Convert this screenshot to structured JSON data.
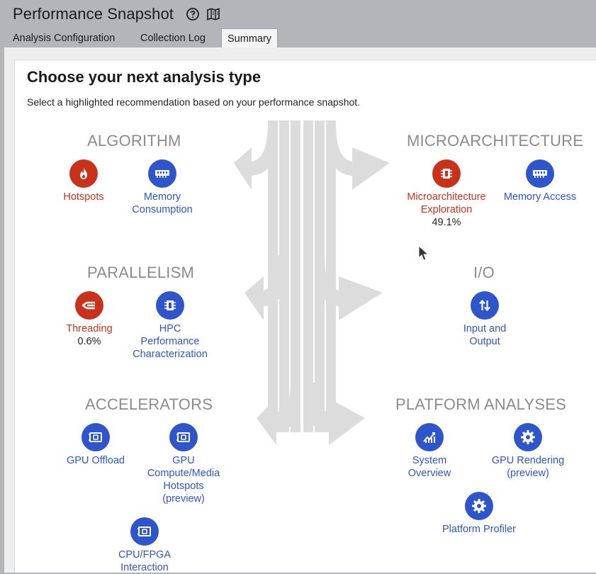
{
  "app": {
    "title": "Performance Snapshot",
    "help_icon": "question-circle-icon",
    "docs_icon": "book-map-icon"
  },
  "tabs": [
    {
      "label": "Analysis Configuration",
      "active": false
    },
    {
      "label": "Collection Log",
      "active": false
    },
    {
      "label": "Summary",
      "active": true
    }
  ],
  "summary": {
    "heading": "Choose your next analysis type",
    "subheading": "Select a highlighted recommendation based on your performance snapshot."
  },
  "sections": {
    "algorithm": {
      "title": "ALGORITHM",
      "items": [
        {
          "label": "Hotspots",
          "icon": "flame-icon",
          "highlight": true
        },
        {
          "label": "Memory\nConsumption",
          "icon": "memory-chip-icon",
          "highlight": false
        }
      ]
    },
    "microarchitecture": {
      "title": "MICROARCHITECTURE",
      "items": [
        {
          "label": "Microarchitecture\nExploration",
          "value": "49.1%",
          "icon": "cpu-icon",
          "highlight": true
        },
        {
          "label": "Memory Access",
          "icon": "memory-chip-icon",
          "highlight": false
        }
      ]
    },
    "parallelism": {
      "title": "PARALLELISM",
      "items": [
        {
          "label": "Threading",
          "value": "0.6%",
          "icon": "threads-icon",
          "highlight": true
        },
        {
          "label": "HPC\nPerformance\nCharacterization",
          "icon": "cpu-icon",
          "highlight": false
        }
      ]
    },
    "io": {
      "title": "I/O",
      "items": [
        {
          "label": "Input and\nOutput",
          "icon": "up-down-arrows-icon",
          "highlight": false
        }
      ]
    },
    "accelerators": {
      "title": "ACCELERATORS",
      "items": [
        {
          "label": "GPU Offload",
          "icon": "gpu-card-icon",
          "highlight": false
        },
        {
          "label": "GPU\nCompute/Media\nHotspots\n(preview)",
          "icon": "gpu-card-icon",
          "highlight": false
        },
        {
          "label": "CPU/FPGA\nInteraction",
          "icon": "fpga-card-icon",
          "highlight": false
        }
      ]
    },
    "platform": {
      "title": "PLATFORM ANALYSES",
      "items": [
        {
          "label": "System\nOverview",
          "icon": "chart-trend-icon",
          "highlight": false
        },
        {
          "label": "GPU Rendering\n(preview)",
          "icon": "gear-icon",
          "highlight": false
        },
        {
          "label": "Platform Profiler",
          "icon": "gear-icon",
          "highlight": false
        }
      ]
    }
  },
  "colors": {
    "blue": "#2e55cc",
    "red": "#c8321b",
    "section_gray": "#8a8b8f",
    "arrow_gray": "#dcdcdc"
  }
}
